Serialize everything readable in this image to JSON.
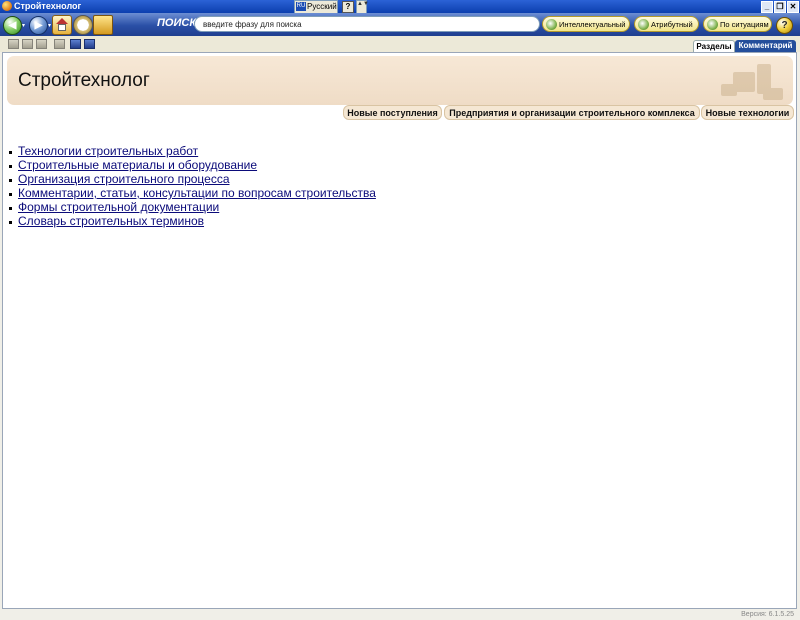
{
  "window": {
    "title": "Стройтехнолог",
    "language_code": "RU",
    "language_label": "Русский",
    "help_glyph": "?",
    "scroll_glyph": "▲▼",
    "controls": [
      "_",
      "❐",
      "✕"
    ]
  },
  "toolbar": {
    "back_glyph": "◀",
    "forward_glyph": "▶",
    "dropdown_glyph": "▾",
    "search_label": "ПОИСК",
    "search_placeholder": "введите фразу для поиска",
    "buttons": [
      "Интеллектуальный",
      "Атрибутный",
      "По ситуациям"
    ],
    "help_glyph": "?"
  },
  "tabs": {
    "sections": "Разделы",
    "comment": "Комментарий"
  },
  "page": {
    "title": "Стройтехнолог",
    "quick_tabs": [
      "Новые поступления",
      "Предприятия и организации строительного комплекса",
      "Новые технологии"
    ],
    "links": [
      "Технологии строительных работ",
      "Строительные материалы и оборудование",
      "Организация строительного процесса",
      "Комментарии, статьи, консультации по вопросам строительства",
      "Формы строительной документации",
      "Словарь строительных терминов"
    ]
  },
  "status": {
    "version": "Версия: 6.1.5.25"
  },
  "colors": {
    "toolbar": "#2a4fa6",
    "header_band": "#f7e8d6",
    "link": "#0b0b7a"
  },
  "icons": [
    "app-icon",
    "back-icon",
    "forward-icon",
    "home-icon",
    "history-icon",
    "folder-icon",
    "search-icon",
    "help-icon"
  ]
}
